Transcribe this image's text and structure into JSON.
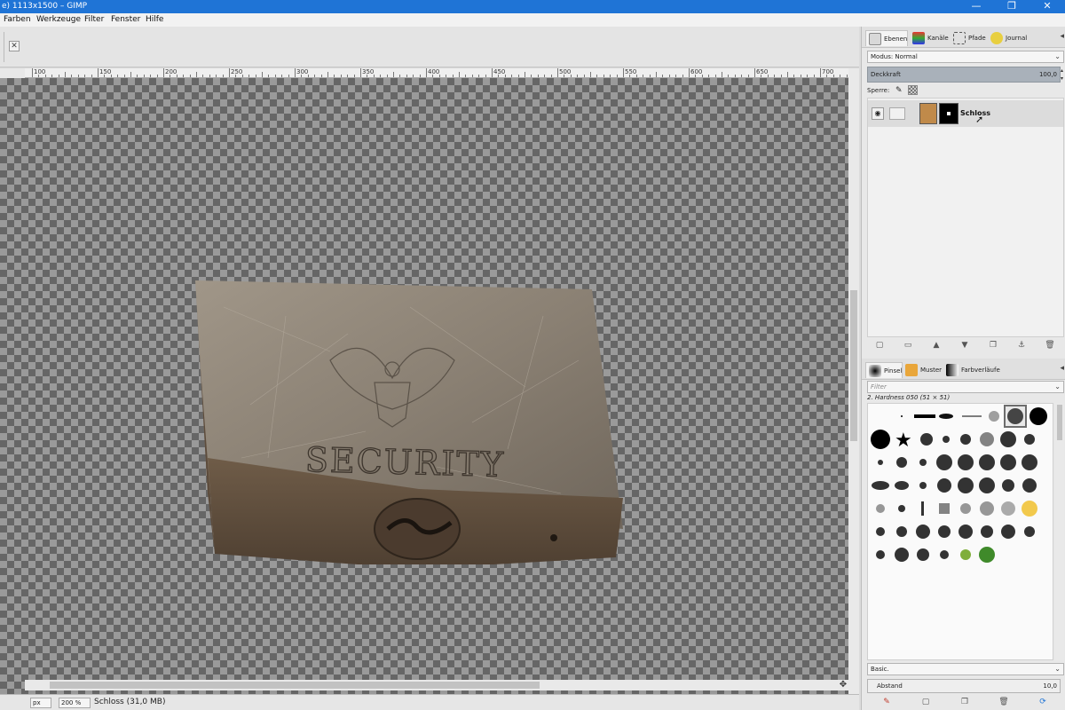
{
  "window": {
    "title": "e) 1113x1500 – GIMP",
    "minimize": "—",
    "maximize": "❐",
    "close": "✕"
  },
  "menu": [
    "Farben",
    "Werkzeuge",
    "Filter",
    "Fenster",
    "Hilfe"
  ],
  "canvas": {
    "tab_close": "✕",
    "ruler_ticks": [
      "100",
      "150",
      "200",
      "250",
      "300",
      "350",
      "400",
      "450",
      "500",
      "550",
      "600",
      "650",
      "700"
    ],
    "image_text": "SECURITY",
    "nav_icon": "✥"
  },
  "statusbar": {
    "unit": "px",
    "zoom": "200 %",
    "info": "Schloss (31,0 MB)"
  },
  "dock": {
    "tabs_top": [
      "Ebenen",
      "Kanäle",
      "Pfade",
      "Journal"
    ],
    "mode_label": "Modus: Normal",
    "opacity_label": "Deckkraft",
    "opacity_value": "100,0",
    "lock_label": "Sperre:",
    "layers": [
      {
        "name": "Schloss"
      }
    ],
    "tabs_bottom": [
      "Pinsel",
      "Muster",
      "Farbverläufe"
    ],
    "filter_placeholder": "Filter",
    "brush_name": "2. Hardness 050 (51 × 51)",
    "brush_set": "Basic.",
    "spacing_label": "Abstand",
    "spacing_value": "10,0"
  },
  "colors": {
    "titlebar": "#1f74d6",
    "pattern_tab": "#e9a63a",
    "layer_thumb": "#c08a4a"
  }
}
